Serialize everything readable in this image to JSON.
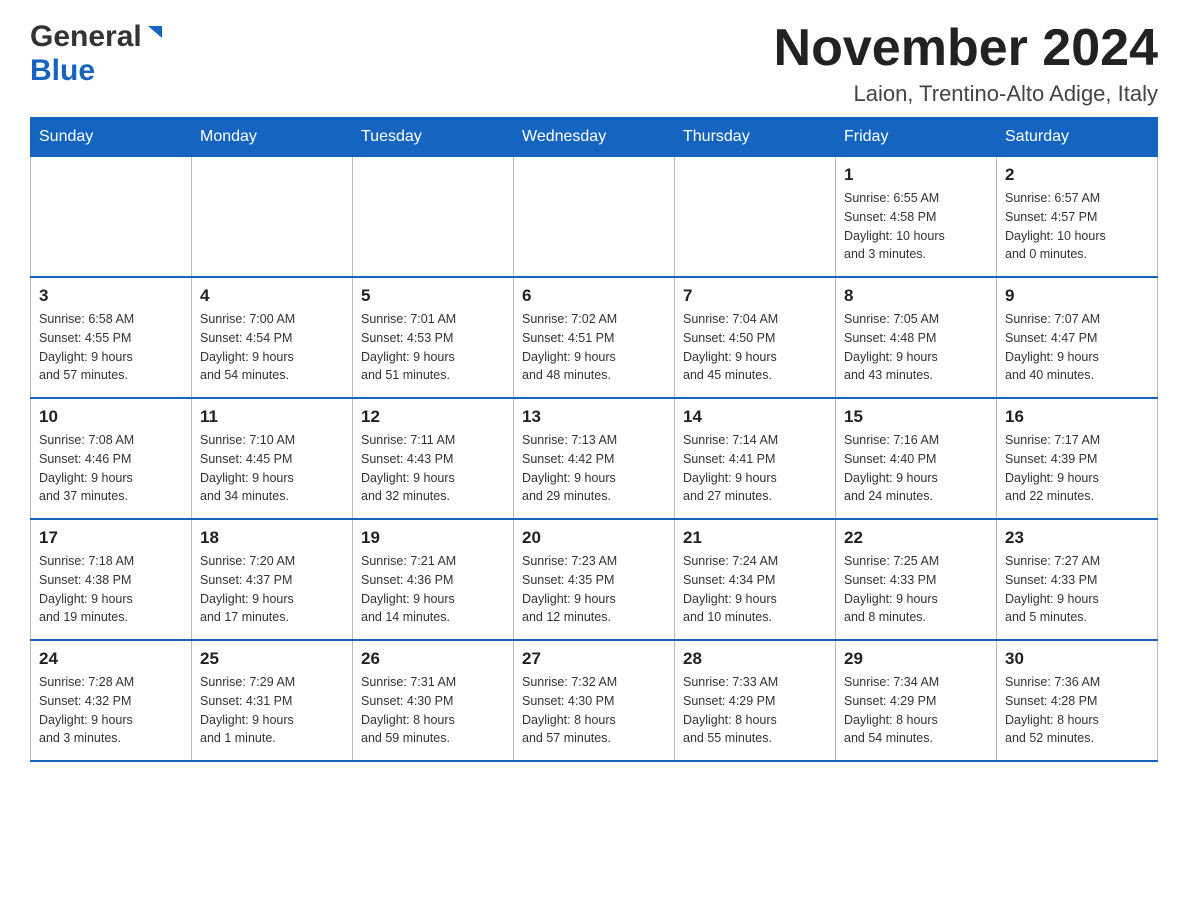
{
  "header": {
    "logo_general": "General",
    "logo_blue": "Blue",
    "month_title": "November 2024",
    "location": "Laion, Trentino-Alto Adige, Italy"
  },
  "weekdays": [
    "Sunday",
    "Monday",
    "Tuesday",
    "Wednesday",
    "Thursday",
    "Friday",
    "Saturday"
  ],
  "weeks": [
    [
      {
        "day": "",
        "info": ""
      },
      {
        "day": "",
        "info": ""
      },
      {
        "day": "",
        "info": ""
      },
      {
        "day": "",
        "info": ""
      },
      {
        "day": "",
        "info": ""
      },
      {
        "day": "1",
        "info": "Sunrise: 6:55 AM\nSunset: 4:58 PM\nDaylight: 10 hours\nand 3 minutes."
      },
      {
        "day": "2",
        "info": "Sunrise: 6:57 AM\nSunset: 4:57 PM\nDaylight: 10 hours\nand 0 minutes."
      }
    ],
    [
      {
        "day": "3",
        "info": "Sunrise: 6:58 AM\nSunset: 4:55 PM\nDaylight: 9 hours\nand 57 minutes."
      },
      {
        "day": "4",
        "info": "Sunrise: 7:00 AM\nSunset: 4:54 PM\nDaylight: 9 hours\nand 54 minutes."
      },
      {
        "day": "5",
        "info": "Sunrise: 7:01 AM\nSunset: 4:53 PM\nDaylight: 9 hours\nand 51 minutes."
      },
      {
        "day": "6",
        "info": "Sunrise: 7:02 AM\nSunset: 4:51 PM\nDaylight: 9 hours\nand 48 minutes."
      },
      {
        "day": "7",
        "info": "Sunrise: 7:04 AM\nSunset: 4:50 PM\nDaylight: 9 hours\nand 45 minutes."
      },
      {
        "day": "8",
        "info": "Sunrise: 7:05 AM\nSunset: 4:48 PM\nDaylight: 9 hours\nand 43 minutes."
      },
      {
        "day": "9",
        "info": "Sunrise: 7:07 AM\nSunset: 4:47 PM\nDaylight: 9 hours\nand 40 minutes."
      }
    ],
    [
      {
        "day": "10",
        "info": "Sunrise: 7:08 AM\nSunset: 4:46 PM\nDaylight: 9 hours\nand 37 minutes."
      },
      {
        "day": "11",
        "info": "Sunrise: 7:10 AM\nSunset: 4:45 PM\nDaylight: 9 hours\nand 34 minutes."
      },
      {
        "day": "12",
        "info": "Sunrise: 7:11 AM\nSunset: 4:43 PM\nDaylight: 9 hours\nand 32 minutes."
      },
      {
        "day": "13",
        "info": "Sunrise: 7:13 AM\nSunset: 4:42 PM\nDaylight: 9 hours\nand 29 minutes."
      },
      {
        "day": "14",
        "info": "Sunrise: 7:14 AM\nSunset: 4:41 PM\nDaylight: 9 hours\nand 27 minutes."
      },
      {
        "day": "15",
        "info": "Sunrise: 7:16 AM\nSunset: 4:40 PM\nDaylight: 9 hours\nand 24 minutes."
      },
      {
        "day": "16",
        "info": "Sunrise: 7:17 AM\nSunset: 4:39 PM\nDaylight: 9 hours\nand 22 minutes."
      }
    ],
    [
      {
        "day": "17",
        "info": "Sunrise: 7:18 AM\nSunset: 4:38 PM\nDaylight: 9 hours\nand 19 minutes."
      },
      {
        "day": "18",
        "info": "Sunrise: 7:20 AM\nSunset: 4:37 PM\nDaylight: 9 hours\nand 17 minutes."
      },
      {
        "day": "19",
        "info": "Sunrise: 7:21 AM\nSunset: 4:36 PM\nDaylight: 9 hours\nand 14 minutes."
      },
      {
        "day": "20",
        "info": "Sunrise: 7:23 AM\nSunset: 4:35 PM\nDaylight: 9 hours\nand 12 minutes."
      },
      {
        "day": "21",
        "info": "Sunrise: 7:24 AM\nSunset: 4:34 PM\nDaylight: 9 hours\nand 10 minutes."
      },
      {
        "day": "22",
        "info": "Sunrise: 7:25 AM\nSunset: 4:33 PM\nDaylight: 9 hours\nand 8 minutes."
      },
      {
        "day": "23",
        "info": "Sunrise: 7:27 AM\nSunset: 4:33 PM\nDaylight: 9 hours\nand 5 minutes."
      }
    ],
    [
      {
        "day": "24",
        "info": "Sunrise: 7:28 AM\nSunset: 4:32 PM\nDaylight: 9 hours\nand 3 minutes."
      },
      {
        "day": "25",
        "info": "Sunrise: 7:29 AM\nSunset: 4:31 PM\nDaylight: 9 hours\nand 1 minute."
      },
      {
        "day": "26",
        "info": "Sunrise: 7:31 AM\nSunset: 4:30 PM\nDaylight: 8 hours\nand 59 minutes."
      },
      {
        "day": "27",
        "info": "Sunrise: 7:32 AM\nSunset: 4:30 PM\nDaylight: 8 hours\nand 57 minutes."
      },
      {
        "day": "28",
        "info": "Sunrise: 7:33 AM\nSunset: 4:29 PM\nDaylight: 8 hours\nand 55 minutes."
      },
      {
        "day": "29",
        "info": "Sunrise: 7:34 AM\nSunset: 4:29 PM\nDaylight: 8 hours\nand 54 minutes."
      },
      {
        "day": "30",
        "info": "Sunrise: 7:36 AM\nSunset: 4:28 PM\nDaylight: 8 hours\nand 52 minutes."
      }
    ]
  ]
}
